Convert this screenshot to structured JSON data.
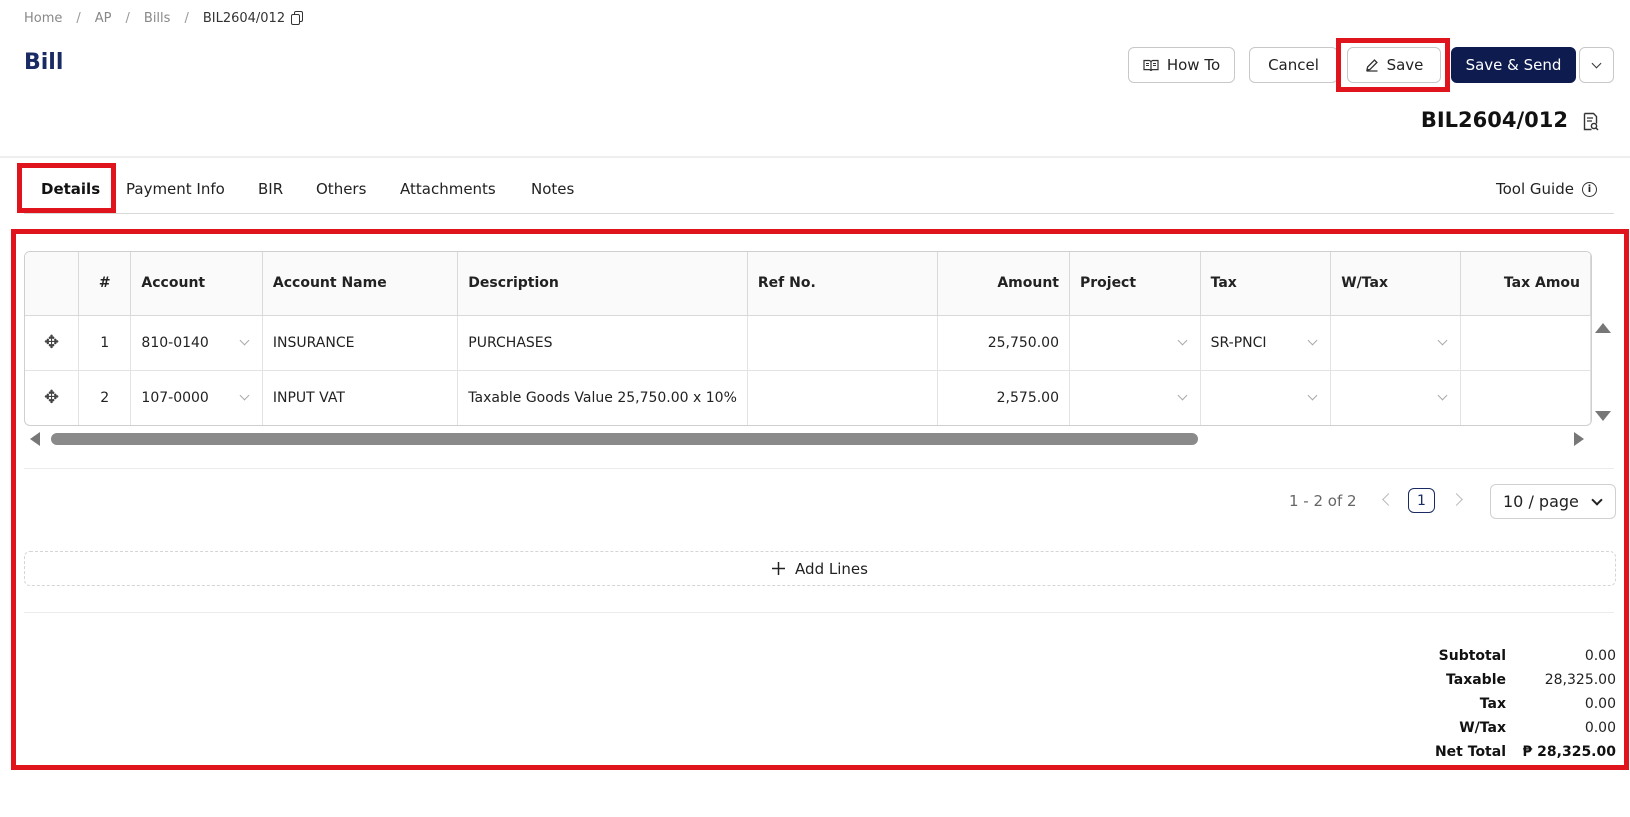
{
  "breadcrumb": {
    "home": "Home",
    "ap": "AP",
    "bills": "Bills",
    "current": "BIL2604/012"
  },
  "page": {
    "title": "Bill",
    "doc_number": "BIL2604/012"
  },
  "actions": {
    "how_to": "How To",
    "cancel": "Cancel",
    "save": "Save",
    "save_send": "Save & Send"
  },
  "tabs": [
    {
      "label": "Details",
      "active": true
    },
    {
      "label": "Payment Info"
    },
    {
      "label": "BIR"
    },
    {
      "label": "Others"
    },
    {
      "label": "Attachments"
    },
    {
      "label": "Notes"
    }
  ],
  "tool_guide": "Tool Guide",
  "table": {
    "columns": [
      "#",
      "Account",
      "Account Name",
      "Description",
      "Ref No.",
      "Amount",
      "Project",
      "Tax",
      "W/Tax",
      "Tax Amou"
    ],
    "rows": [
      {
        "num": "1",
        "account": "810-0140",
        "account_name": "INSURANCE",
        "description": "PURCHASES",
        "ref_no": "",
        "amount": "25,750.00",
        "project": "",
        "tax": "SR-PNCI",
        "wtax": "",
        "tax_amount": ""
      },
      {
        "num": "2",
        "account": "107-0000",
        "account_name": "INPUT VAT",
        "description": "Taxable Goods Value 25,750.00 x 10%",
        "ref_no": "",
        "amount": "2,575.00",
        "project": "",
        "tax": "",
        "wtax": "",
        "tax_amount": ""
      }
    ]
  },
  "pagination": {
    "range": "1 - 2 of 2",
    "current_page": "1",
    "page_size": "10 / page"
  },
  "add_lines": "Add Lines",
  "totals": {
    "subtotal_label": "Subtotal",
    "subtotal": "0.00",
    "taxable_label": "Taxable",
    "taxable": "28,325.00",
    "tax_label": "Tax",
    "tax": "0.00",
    "wtax_label": "W/Tax",
    "wtax": "0.00",
    "net_label": "Net Total",
    "net": "₱ 28,325.00"
  },
  "colors": {
    "brand": "#1a2a63",
    "primary_button": "#0e1b4f",
    "highlight": "#e0141c"
  },
  "icons": [
    "copy-icon",
    "book-icon",
    "pencil-icon",
    "chevron-down-icon",
    "document-search-icon",
    "info-icon",
    "move-icon",
    "plus-icon"
  ]
}
